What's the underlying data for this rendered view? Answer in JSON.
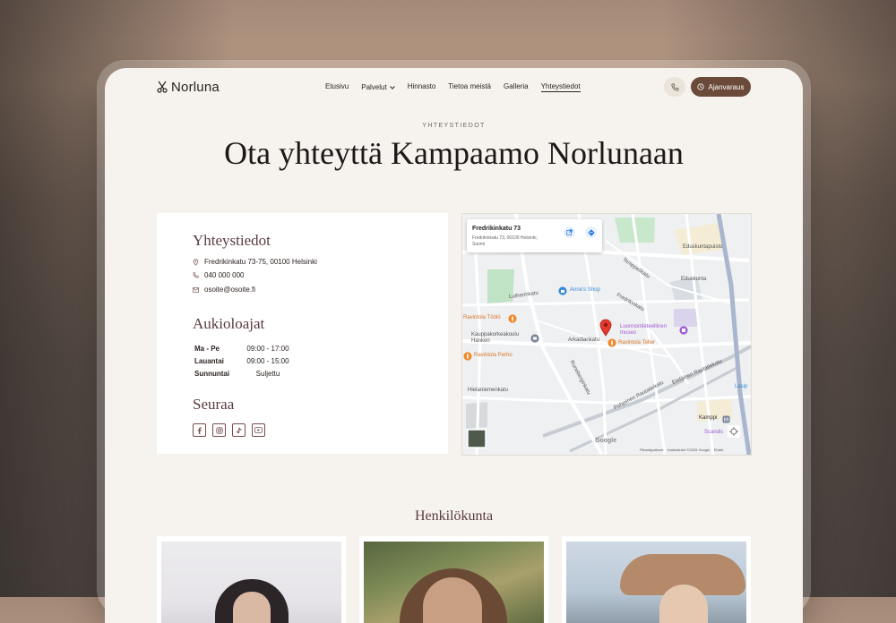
{
  "brand": {
    "name": "Norluna"
  },
  "nav": {
    "items": [
      "Etusivu",
      "Palvelut",
      "Hinnasto",
      "Tietoa meistä",
      "Galleria",
      "Yhteystiedot"
    ],
    "active": "Yhteystiedot"
  },
  "header": {
    "booking_label": "Ajanvaraus"
  },
  "hero": {
    "eyebrow": "YHTEYSTIEDOT",
    "title": "Ota yhteyttä Kampaamo Norlunaan"
  },
  "contact": {
    "heading": "Yhteystiedot",
    "address": "Fredrikinkatu 73-75, 00100 Helsinki",
    "phone": "040 000 000",
    "email": "osoite@osoite.fi"
  },
  "hours": {
    "heading": "Aukioloajat",
    "rows": [
      {
        "day": "Ma - Pe",
        "time": "09:00 - 17:00"
      },
      {
        "day": "Lauantai",
        "time": "09:00 - 15:00"
      },
      {
        "day": "Sunnuntai",
        "time": "Suljettu"
      }
    ]
  },
  "follow": {
    "heading": "Seuraa",
    "icons": [
      "facebook-icon",
      "instagram-icon",
      "tiktok-icon",
      "youtube-icon"
    ]
  },
  "map": {
    "place_title": "Fredrikinkatu 73",
    "place_address": "Fredrikinkatu 73, 00100 Helsinki, Suomi",
    "labels": {
      "annes_shop": "Anne's Shop",
      "ravintola_toolo": "Ravintola Töölö",
      "kauppakorkeakoulu": "Kauppakorkeakoulu Hanken",
      "arkadiankatu": "Arkadiankatu",
      "ravintola_teller": "Ravintola Teller",
      "museo": "Luonnontieteellinen museo",
      "ravintola_perho": "Ravintola Perho",
      "runeberginkatu": "Runeberginkatu",
      "hietaniemenkatu": "Hietaniemenkatu",
      "pohjoinen_rautatiekatu": "Pohjoinen Rautatiekatu",
      "lutherinkatu": "Lutherinkatu",
      "eduskunta": "Eduskunta",
      "eduskuntapuisto": "Eduskuntapuisto",
      "kamppi": "Kamppi",
      "scandic": "Scandic",
      "temppelikatu": "Temppelikatu",
      "fredrikinkatu": "Fredrikinkatu",
      "lasipalatsi": "Lasip",
      "eteläinen": "Eteläinen Rautatiekatu",
      "google": "Google"
    },
    "footer": [
      "Pikanäppäimet",
      "Karttatiedot ©2025 Google",
      "Ehdot"
    ]
  },
  "staff": {
    "heading": "Henkilökunta"
  },
  "colors": {
    "accent": "#6b4a3a",
    "heading": "#5a3a40",
    "page_bg": "#f6f3ee"
  }
}
